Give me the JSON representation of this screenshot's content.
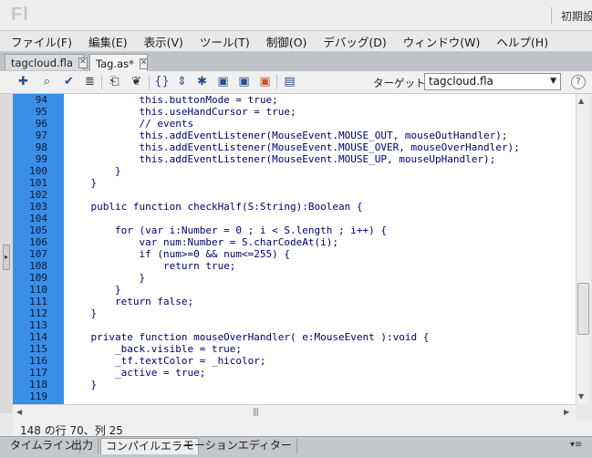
{
  "app": {
    "logo": "Fl",
    "workspace": "初期設定"
  },
  "menu": [
    "ファイル(F)",
    "編集(E)",
    "表示(V)",
    "ツール(T)",
    "制御(O)",
    "デバッグ(D)",
    "ウィンドウ(W)",
    "ヘルプ(H)"
  ],
  "tabs": [
    {
      "label": "tagcloud.fla",
      "active": false
    },
    {
      "label": "Tag.as*",
      "active": true
    }
  ],
  "toolbar": {
    "icons": [
      "add-script-icon",
      "find-icon",
      "check-syntax-icon",
      "auto-format-icon",
      "code-hint-icon",
      "debug-options-icon",
      "collapse-between-braces-icon",
      "collapse-selection-icon",
      "expand-all-icon",
      "apply-block-comment-icon",
      "apply-line-comment-icon",
      "remove-comment-icon",
      "toggle-help-icon"
    ],
    "target_label": "ターゲット：",
    "target_value": "tagcloud.fla"
  },
  "code": [
    {
      "n": "94",
      "t": "            this.buttonMode = true;"
    },
    {
      "n": "95",
      "t": "            this.useHandCursor = true;"
    },
    {
      "n": "96",
      "t": "            // events"
    },
    {
      "n": "97",
      "t": "            this.addEventListener(MouseEvent.MOUSE_OUT, mouseOutHandler);"
    },
    {
      "n": "98",
      "t": "            this.addEventListener(MouseEvent.MOUSE_OVER, mouseOverHandler);"
    },
    {
      "n": "99",
      "t": "            this.addEventListener(MouseEvent.MOUSE_UP, mouseUpHandler);"
    },
    {
      "n": "100",
      "t": "        }"
    },
    {
      "n": "101",
      "t": "    }"
    },
    {
      "n": "102",
      "t": ""
    },
    {
      "n": "103",
      "t": "    public function checkHalf(S:String):Boolean {"
    },
    {
      "n": "104",
      "t": ""
    },
    {
      "n": "105",
      "t": "        for (var i:Number = 0 ; i < S.length ; i++) {"
    },
    {
      "n": "106",
      "t": "            var num:Number = S.charCodeAt(i);"
    },
    {
      "n": "107",
      "t": "            if (num>=0 && num<=255) {"
    },
    {
      "n": "108",
      "t": "                return true;"
    },
    {
      "n": "109",
      "t": "            }"
    },
    {
      "n": "110",
      "t": "        }"
    },
    {
      "n": "111",
      "t": "        return false;"
    },
    {
      "n": "112",
      "t": "    }"
    },
    {
      "n": "113",
      "t": ""
    },
    {
      "n": "114",
      "t": "    private function mouseOverHandler( e:MouseEvent ):void {"
    },
    {
      "n": "115",
      "t": "        _back.visible = true;"
    },
    {
      "n": "116",
      "t": "        _tf.textColor = _hicolor;"
    },
    {
      "n": "117",
      "t": "        _active = true;"
    },
    {
      "n": "118",
      "t": "    }"
    },
    {
      "n": "119",
      "t": ""
    }
  ],
  "status": "148 の行 70、列 25",
  "bottom_tabs": [
    "タイムライン",
    "出力",
    "コンパイルエラー",
    "モーションエディター"
  ],
  "bottom_active": "コンパイルエラー"
}
